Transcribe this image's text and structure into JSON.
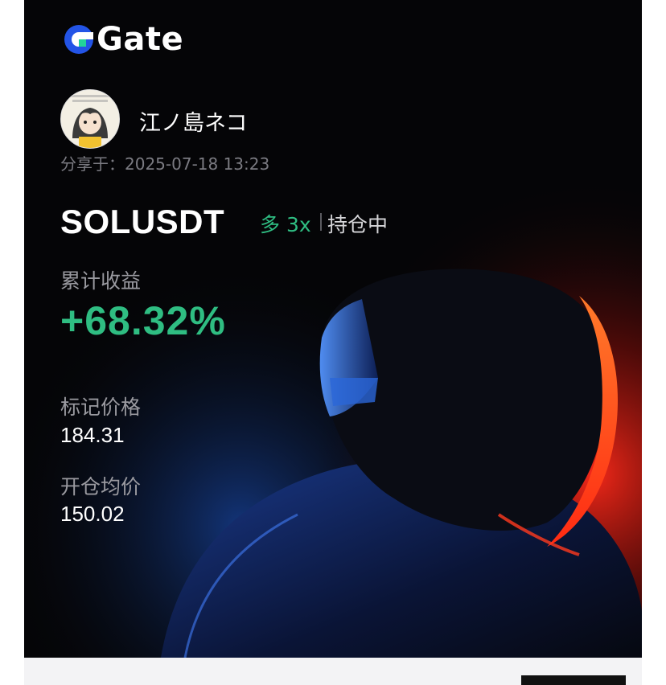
{
  "brand": {
    "name": "Gate",
    "color": "#2354e6"
  },
  "user": {
    "name": "江ノ島ネコ",
    "avatar_icon": "anime-avatar"
  },
  "share": {
    "time_label": "分享于：2025-07-18 13:23"
  },
  "position": {
    "pair": "SOLUSDT",
    "direction": "多 3x",
    "status": "持仓中",
    "pnl_label": "累计收益",
    "pnl_value": "+68.32%",
    "mark_price_label": "标记价格",
    "mark_price": "184.31",
    "entry_price_label": "开仓均价",
    "entry_price": "150.02"
  },
  "colors": {
    "profit": "#2fbd82",
    "background": "#050507",
    "glow_blue": "#1e5bd6",
    "glow_red": "#ff2a1a"
  }
}
